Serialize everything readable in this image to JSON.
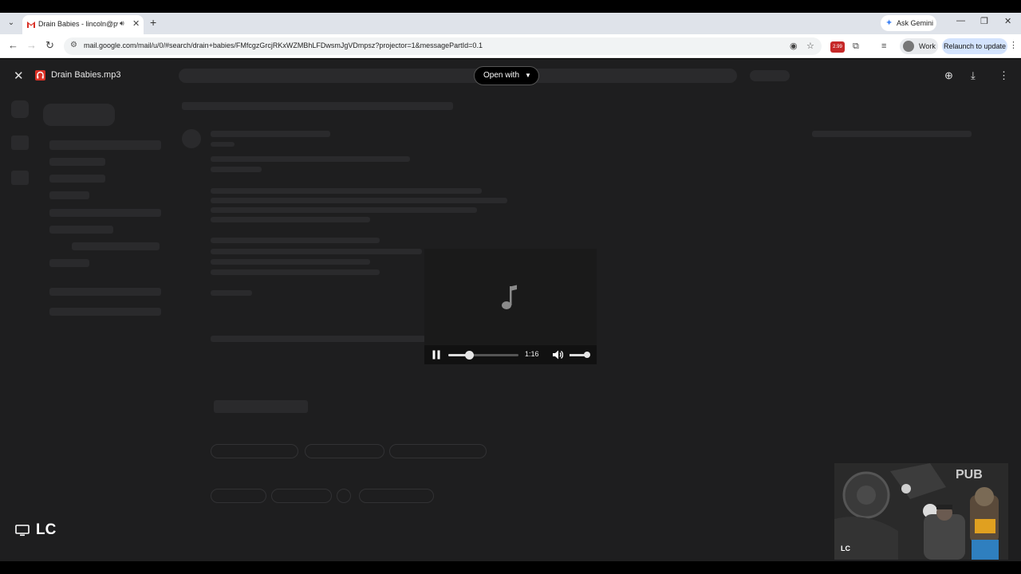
{
  "browser": {
    "tab": {
      "title": "Drain Babies - lincoln@pvc",
      "favicon": "gmail-icon",
      "audio_icon": "speaker-icon"
    },
    "new_tab_label": "+",
    "ask_gemini": "Ask Gemini",
    "url": "mail.google.com/mail/u/0/#search/drain+babies/FMfcgzGrcjRKxWZMBhLFDwsmJgVDmpsz?projector=1&messagePartId=0.1",
    "profile_label": "Work",
    "relaunch_label": "Relaunch to update"
  },
  "viewer": {
    "filename": "Drain Babies.mp3",
    "open_with_label": "Open with",
    "actions": [
      "add-to-drive-icon",
      "download-icon",
      "more-vert-icon"
    ]
  },
  "player": {
    "state": "playing",
    "time": "1:16",
    "progress_fraction": 0.3,
    "volume_fraction": 0.85
  },
  "overlays": {
    "presenter_label": "LC",
    "webcam_label": "LC",
    "webcam_sign": "PUB"
  }
}
